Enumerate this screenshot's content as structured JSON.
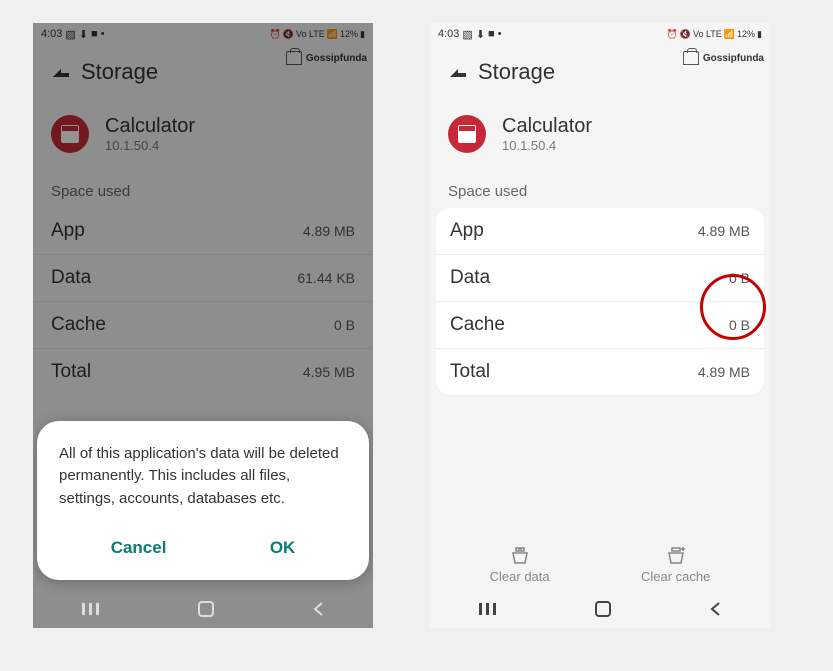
{
  "status": {
    "time": "4:03",
    "battery": "12%"
  },
  "watermark": "Gossipfunda",
  "header": {
    "title": "Storage"
  },
  "app": {
    "name": "Calculator",
    "version": "10.1.50.4"
  },
  "section_label": "Space used",
  "left": {
    "rows": [
      {
        "label": "App",
        "value": "4.89 MB"
      },
      {
        "label": "Data",
        "value": "61.44 KB"
      },
      {
        "label": "Cache",
        "value": "0 B"
      },
      {
        "label": "Total",
        "value": "4.95 MB"
      }
    ],
    "dialog": {
      "message": "All of this application's data will be deleted permanently. This includes all files, settings, accounts, databases etc.",
      "cancel": "Cancel",
      "ok": "OK"
    }
  },
  "right": {
    "rows": [
      {
        "label": "App",
        "value": "4.89 MB"
      },
      {
        "label": "Data",
        "value": "0 B"
      },
      {
        "label": "Cache",
        "value": "0 B"
      },
      {
        "label": "Total",
        "value": "4.89 MB"
      }
    ],
    "actions": {
      "clear_data": "Clear data",
      "clear_cache": "Clear cache"
    }
  }
}
